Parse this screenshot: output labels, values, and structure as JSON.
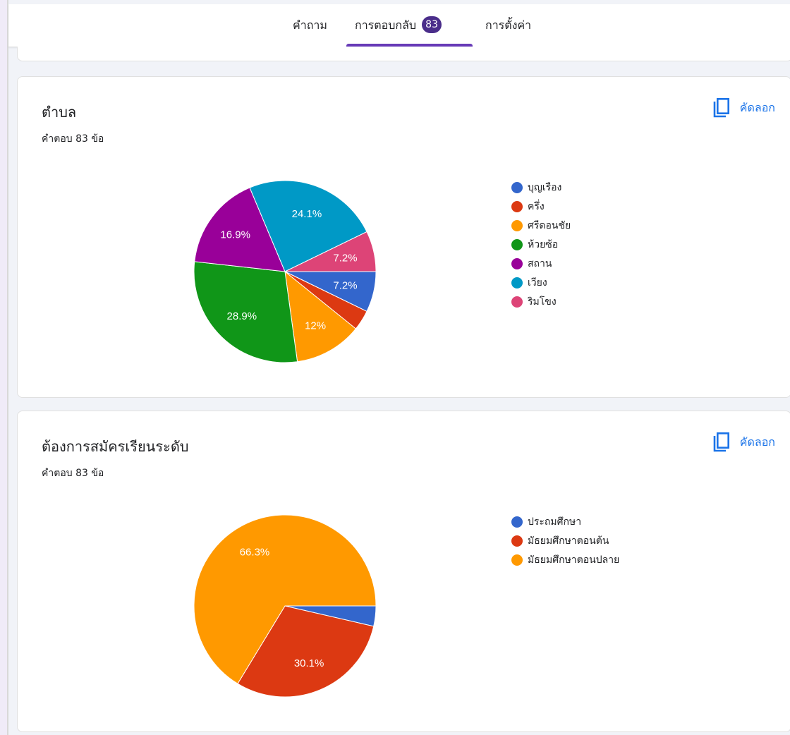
{
  "tabs": [
    {
      "label": "คำถาม"
    },
    {
      "label": "การตอบกลับ",
      "badge": "83"
    },
    {
      "label": "การตั้งค่า"
    }
  ],
  "copy_label": "คัดลอก",
  "cards": [
    {
      "title": "ตำบล",
      "subtitle": "คำตอบ 83 ข้อ"
    },
    {
      "title": "ต้องการสมัครเรียนระดับ",
      "subtitle": "คำตอบ 83 ข้อ"
    }
  ],
  "chart_data": [
    {
      "type": "pie",
      "title": "ตำบล",
      "categories": [
        "บุญเรือง",
        "ครึ่ง",
        "ศรีดอนชัย",
        "ห้วยซ้อ",
        "สถาน",
        "เวียง",
        "ริมโขง"
      ],
      "values": [
        7.2,
        3.6,
        12,
        28.9,
        16.9,
        24.1,
        7.2
      ],
      "labels": [
        "7.2%",
        "",
        "12%",
        "28.9%",
        "16.9%",
        "24.1%",
        "7.2%"
      ],
      "colors": [
        "#3366cc",
        "#dc3912",
        "#ff9900",
        "#109618",
        "#990099",
        "#0099c6",
        "#dd4477"
      ],
      "legend": "right"
    },
    {
      "type": "pie",
      "title": "ต้องการสมัครเรียนระดับ",
      "categories": [
        "ประถมศึกษา",
        "มัธยมศึกษาตอนต้น",
        "มัธยมศึกษาตอนปลาย"
      ],
      "values": [
        3.6,
        30.1,
        66.3
      ],
      "labels": [
        "",
        "30.1%",
        "66.3%"
      ],
      "colors": [
        "#3366cc",
        "#dc3912",
        "#ff9900"
      ],
      "legend": "right"
    }
  ]
}
